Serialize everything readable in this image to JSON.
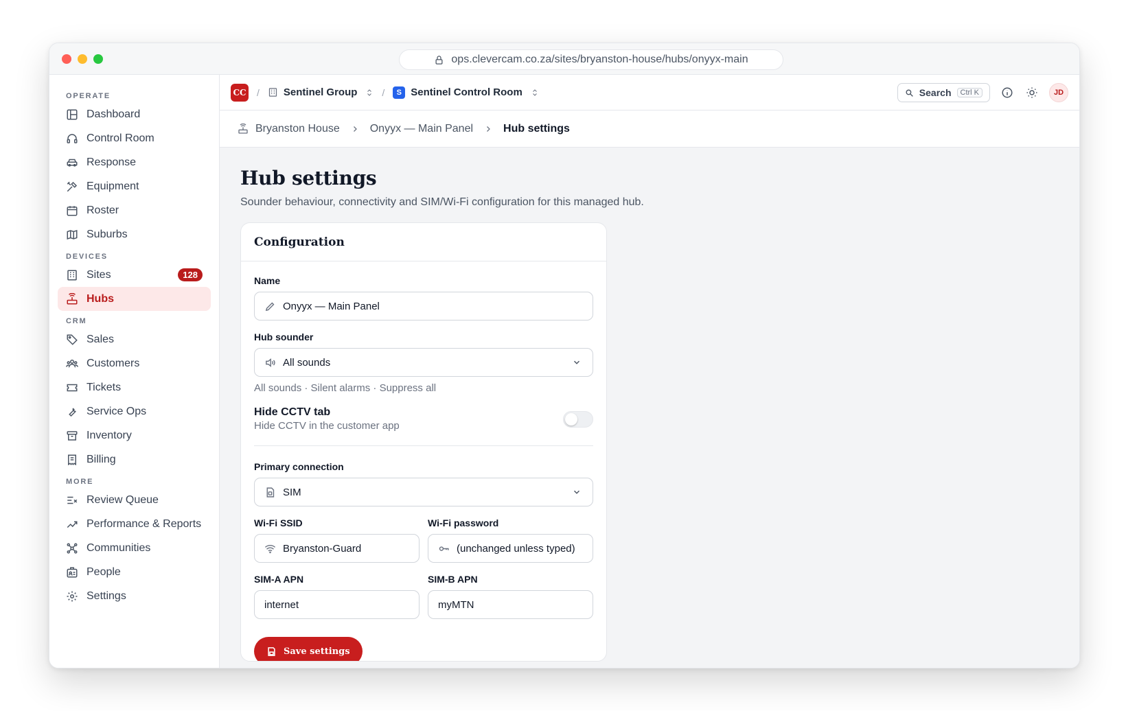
{
  "browser": {
    "url": "ops.clevercam.co.za/sites/bryanston-house/hubs/onyyx-main"
  },
  "sidebar": {
    "sections": [
      {
        "title": "OPERATE",
        "items": [
          {
            "label": "Dashboard",
            "icon": "layout-icon"
          },
          {
            "label": "Control Room",
            "icon": "headset-icon"
          },
          {
            "label": "Response",
            "icon": "car-icon"
          },
          {
            "label": "Equipment",
            "icon": "tools-icon"
          },
          {
            "label": "Roster",
            "icon": "calendar-icon"
          },
          {
            "label": "Suburbs",
            "icon": "map-icon"
          }
        ]
      },
      {
        "title": "DEVICES",
        "items": [
          {
            "label": "Sites",
            "icon": "building-icon",
            "badge": "128"
          },
          {
            "label": "Hubs",
            "icon": "router-icon",
            "active": true
          }
        ]
      },
      {
        "title": "CRM",
        "items": [
          {
            "label": "Sales",
            "icon": "tag-icon"
          },
          {
            "label": "Customers",
            "icon": "users-icon"
          },
          {
            "label": "Tickets",
            "icon": "ticket-icon"
          },
          {
            "label": "Service Ops",
            "icon": "wrench-icon"
          },
          {
            "label": "Inventory",
            "icon": "archive-icon"
          },
          {
            "label": "Billing",
            "icon": "receipt-icon"
          }
        ]
      },
      {
        "title": "MORE",
        "items": [
          {
            "label": "Review Queue",
            "icon": "list-check-icon"
          },
          {
            "label": "Performance & Reports",
            "icon": "trend-icon"
          },
          {
            "label": "Communities",
            "icon": "network-icon"
          },
          {
            "label": "People",
            "icon": "id-card-icon"
          },
          {
            "label": "Settings",
            "icon": "gear-icon"
          }
        ]
      }
    ]
  },
  "topbar": {
    "logo": "CC",
    "org": "Sentinel Group",
    "workspace_logo": "S",
    "workspace": "Sentinel Control Room",
    "search_label": "Search",
    "search_shortcut": "Ctrl K",
    "avatar": "JD"
  },
  "breadcrumb": {
    "site": "Bryanston House",
    "hub": "Onyyx — Main Panel",
    "current": "Hub settings"
  },
  "page": {
    "title": "Hub settings",
    "subtitle": "Sounder behaviour, connectivity and SIM/Wi-Fi configuration for this managed hub."
  },
  "form": {
    "card_title": "Configuration",
    "name_label": "Name",
    "name_value": "Onyyx — Main Panel",
    "sounder_label": "Hub sounder",
    "sounder_value": "All sounds",
    "sounder_hint": "All sounds · Silent alarms · Suppress all",
    "cctv_title": "Hide CCTV tab",
    "cctv_sub": "Hide CCTV in the customer app",
    "cctv_enabled": false,
    "connection_label": "Primary connection",
    "connection_value": "SIM",
    "ssid_label": "Wi-Fi SSID",
    "ssid_value": "Bryanston-Guard",
    "wifi_pw_label": "Wi-Fi password",
    "wifi_pw_placeholder": "(unchanged unless typed)",
    "sima_label": "SIM-A APN",
    "sima_value": "internet",
    "simb_label": "SIM-B APN",
    "simb_value": "myMTN",
    "save_label": "Save settings"
  },
  "colors": {
    "accent": "#c81e1e",
    "active_bg": "#fde8e8",
    "workspace_blue": "#2563eb"
  }
}
